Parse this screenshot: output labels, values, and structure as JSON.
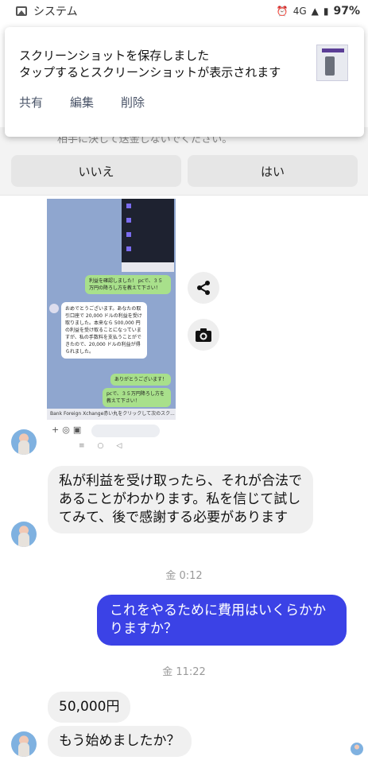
{
  "status_bar": {
    "network": "4G",
    "battery": "97%",
    "app_name": "システム"
  },
  "notification": {
    "title": "スクリーンショットを保存しました",
    "text": "タップするとスクリーンショットが表示されます",
    "actions": [
      "共有",
      "編集",
      "削除"
    ]
  },
  "dialog": {
    "hidden_text": "相手に決して送金しないでください。",
    "no_label": "いいえ",
    "yes_label": "はい"
  },
  "shared_screenshot": {
    "bubble_1": "利益を確認しました！\npcで、３５万円の降ろし方を教えて下さい！",
    "bubble_2": "おめでとうございます。あなたの取引口座で 20,000 ドルの利益を受け取りました。本来なら 500,000 円の利益を受け取ることになっていますが、私の手数料を支払うことができたので、20,000 ドルの利益が得られました。",
    "bubble_3": "ありがとうございます！",
    "bubble_4": "pcで、３５万円降ろし方を教えて下さい！",
    "caption": "Bank Foreign Xchange赤い丸をクリックして次のスク..."
  },
  "messages": {
    "msg_1": "私が利益を受け取ったら、それが合法であることがわかります。私を信じて試してみて、後で感謝する必要があります",
    "time_1": "金 0:12",
    "msg_2": "これをやるために費用はいくらかかりますか？",
    "time_2": "金 11:22",
    "msg_3": "50,000円",
    "msg_4": "もう始めましたか？"
  },
  "colors": {
    "outgoing_bubble": "#3b42e6",
    "incoming_bubble": "#f0f0f0"
  },
  "icons": [
    "gallery-icon",
    "alarm-icon",
    "signal-icon",
    "battery-icon",
    "share-icon",
    "camera-icon"
  ]
}
